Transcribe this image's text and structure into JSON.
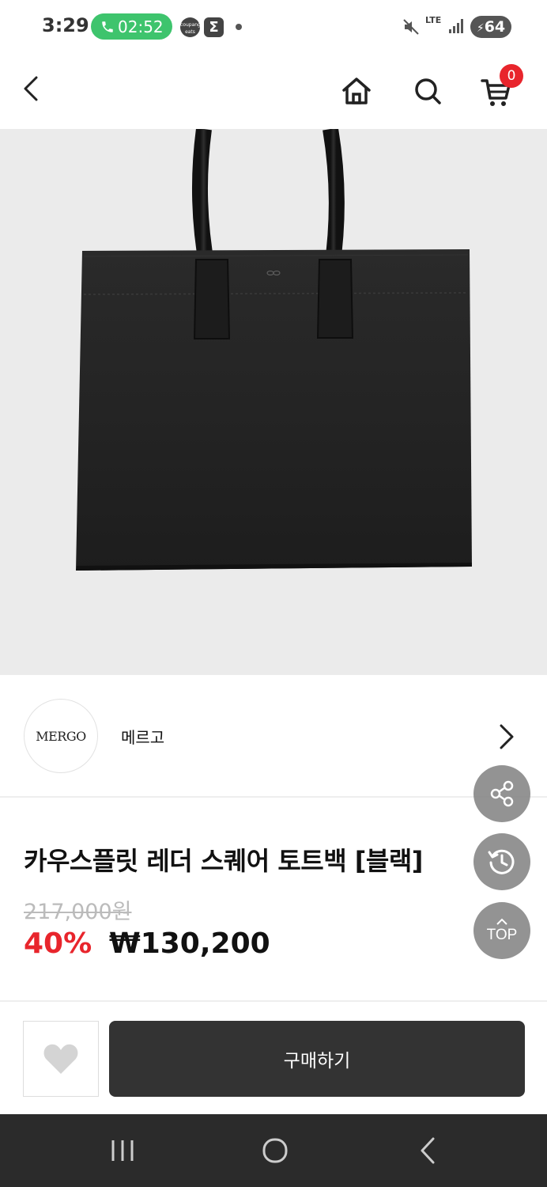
{
  "status_bar": {
    "time": "3:29",
    "call_timer": "02:52",
    "eats_label": "coupang eats",
    "sigma_label": "Σ",
    "network": "LTE",
    "battery": "64"
  },
  "header": {
    "cart_count": "0"
  },
  "brand": {
    "logo_text": "MERGO",
    "name": "메르고"
  },
  "product": {
    "title": "카우스플릿 레더 스퀘어 토트백 [블랙]",
    "original_price": "217,000원",
    "discount": "40%",
    "price": "₩130,200"
  },
  "floating": {
    "top_label": "TOP"
  },
  "actions": {
    "buy_label": "구매하기"
  },
  "colors": {
    "accent_red": "#e8252c",
    "buy_button": "#333333",
    "call_green": "#3ec46d"
  }
}
